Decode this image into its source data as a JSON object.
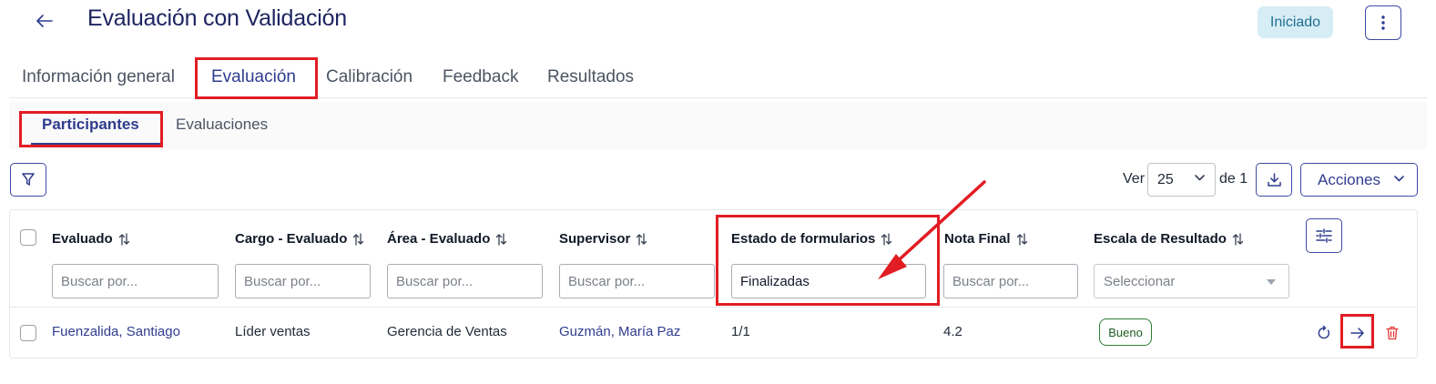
{
  "header": {
    "title": "Evaluación con Validación",
    "status": "Iniciado"
  },
  "main_tabs": [
    {
      "label": "Información general"
    },
    {
      "label": "Evaluación"
    },
    {
      "label": "Calibración"
    },
    {
      "label": "Feedback"
    },
    {
      "label": "Resultados"
    }
  ],
  "sub_tabs": [
    {
      "label": "Participantes"
    },
    {
      "label": "Evaluaciones"
    }
  ],
  "toolbar": {
    "ver_label": "Ver",
    "page_size": "25",
    "de_label": "de 1",
    "acciones_label": "Acciones"
  },
  "table": {
    "columns": [
      {
        "label": "Evaluado",
        "placeholder": "Buscar por..."
      },
      {
        "label": "Cargo - Evaluado",
        "placeholder": "Buscar por..."
      },
      {
        "label": "Área - Evaluado",
        "placeholder": "Buscar por..."
      },
      {
        "label": "Supervisor",
        "placeholder": "Buscar por..."
      },
      {
        "label": "Estado de formularios",
        "value": "Finalizadas"
      },
      {
        "label": "Nota Final",
        "placeholder": "Buscar por..."
      },
      {
        "label": "Escala de Resultado",
        "placeholder": "Seleccionar"
      }
    ],
    "rows": [
      {
        "evaluado": "Fuenzalida, Santiago",
        "cargo": "Líder ventas",
        "area": "Gerencia de Ventas",
        "supervisor": "Guzmán, María Paz",
        "estado": "1/1",
        "nota": "4.2",
        "escala": "Bueno"
      }
    ]
  },
  "colors": {
    "primary": "#2f3c8f",
    "highlight": "#e11d23",
    "badge_bg": "#d7edf6",
    "success": "#2e7d32",
    "danger": "#e53935"
  },
  "icons": [
    "arrow-left-icon",
    "kebab-icon",
    "filter-icon",
    "chevron-down-icon",
    "download-icon",
    "sliders-icon",
    "sort-icon",
    "refresh-icon",
    "arrow-right-icon",
    "trash-icon"
  ]
}
